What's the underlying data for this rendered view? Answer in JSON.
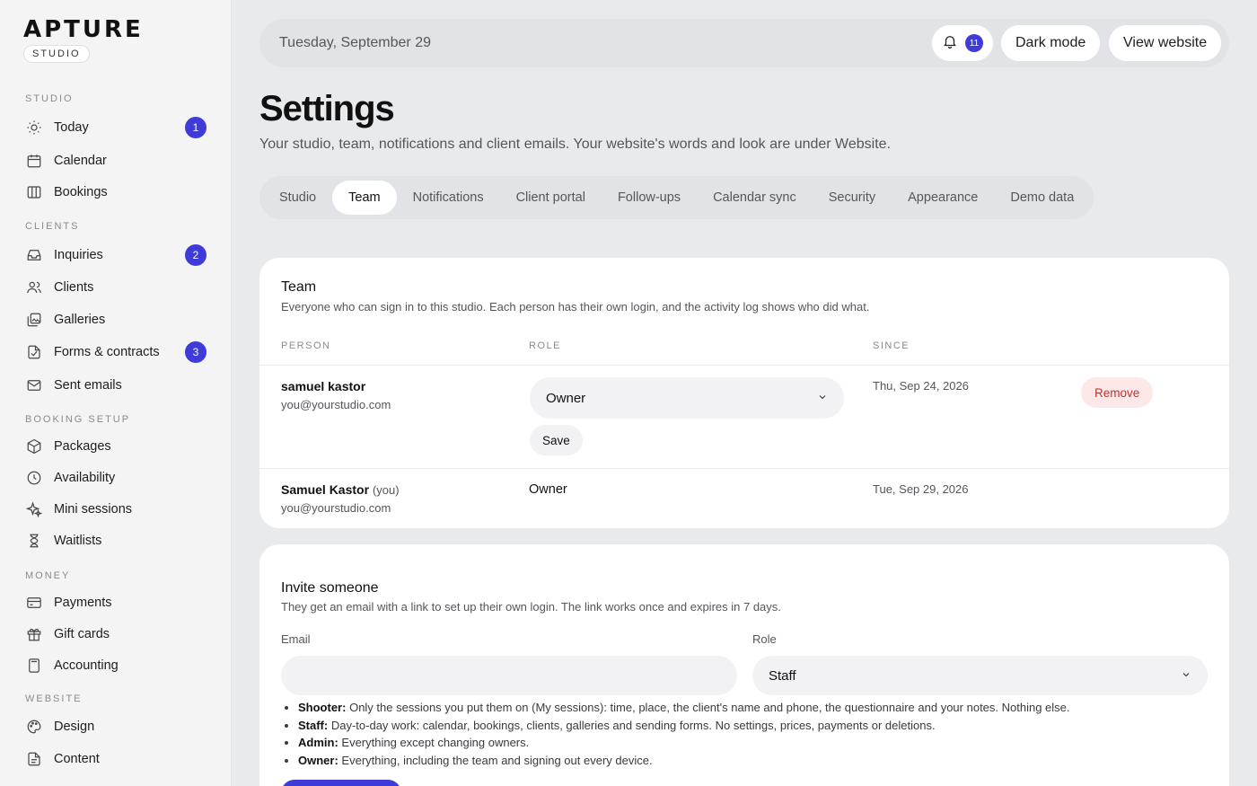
{
  "brand": {
    "logo": "APTURE",
    "tag": "STUDIO"
  },
  "sidebar": {
    "sections": [
      {
        "label": "STUDIO",
        "items": [
          {
            "label": "Today",
            "icon": "sun-icon",
            "badge": "1"
          },
          {
            "label": "Calendar",
            "icon": "calendar-icon"
          },
          {
            "label": "Bookings",
            "icon": "columns-icon"
          }
        ]
      },
      {
        "label": "CLIENTS",
        "items": [
          {
            "label": "Inquiries",
            "icon": "inbox-icon",
            "badge": "2"
          },
          {
            "label": "Clients",
            "icon": "users-icon"
          },
          {
            "label": "Galleries",
            "icon": "gallery-icon"
          },
          {
            "label": "Forms & contracts",
            "icon": "document-icon",
            "badge": "3"
          },
          {
            "label": "Sent emails",
            "icon": "mail-icon"
          }
        ]
      },
      {
        "label": "BOOKING SETUP",
        "items": [
          {
            "label": "Packages",
            "icon": "package-icon"
          },
          {
            "label": "Availability",
            "icon": "clock-icon"
          },
          {
            "label": "Mini sessions",
            "icon": "sparkles-icon"
          },
          {
            "label": "Waitlists",
            "icon": "hourglass-icon"
          }
        ]
      },
      {
        "label": "MONEY",
        "items": [
          {
            "label": "Payments",
            "icon": "credit-card-icon"
          },
          {
            "label": "Gift cards",
            "icon": "gift-icon"
          },
          {
            "label": "Accounting",
            "icon": "calculator-icon"
          }
        ]
      },
      {
        "label": "WEBSITE",
        "items": [
          {
            "label": "Design",
            "icon": "palette-icon"
          },
          {
            "label": "Content",
            "icon": "content-icon"
          }
        ]
      }
    ]
  },
  "topbar": {
    "date": "Tuesday, September 29",
    "notifications_count": "11",
    "dark_mode_label": "Dark mode",
    "view_website_label": "View website"
  },
  "header": {
    "title": "Settings",
    "subtitle": "Your studio, team, notifications and client emails. Your website's words and look are under Website."
  },
  "tabs": [
    "Studio",
    "Team",
    "Notifications",
    "Client portal",
    "Follow-ups",
    "Calendar sync",
    "Security",
    "Appearance",
    "Demo data"
  ],
  "active_tab": "Team",
  "team": {
    "title": "Team",
    "subtitle": "Everyone who can sign in to this studio. Each person has their own login, and the activity log shows who did what.",
    "columns": {
      "person": "PERSON",
      "role": "ROLE",
      "since": "SINCE"
    },
    "members": [
      {
        "name": "samuel kastor",
        "you": "",
        "email": "you@yourstudio.com",
        "role": "Owner",
        "since": "Thu, Sep 24, 2026",
        "save_label": "Save",
        "remove_label": "Remove"
      },
      {
        "name": "Samuel Kastor",
        "you": "(you)",
        "email": "you@yourstudio.com",
        "role": "Owner",
        "since": "Tue, Sep 29, 2026"
      }
    ]
  },
  "invite": {
    "title": "Invite someone",
    "subtitle": "They get an email with a link to set up their own login. The link works once and expires in 7 days.",
    "email_label": "Email",
    "email_value": "",
    "role_label": "Role",
    "role_value": "Staff",
    "roles": [
      {
        "name": "Shooter:",
        "desc": "Only the sessions you put them on (My sessions): time, place, the client's name and phone, the questionnaire and your notes. Nothing else."
      },
      {
        "name": "Staff:",
        "desc": "Day-to-day work: calendar, bookings, clients, galleries and sending forms. No settings, prices, payments or deletions."
      },
      {
        "name": "Admin:",
        "desc": "Everything except changing owners."
      },
      {
        "name": "Owner:",
        "desc": "Everything, including the team and signing out every device."
      }
    ]
  },
  "colors": {
    "accent": "#3f3bd9",
    "danger": "#c53030",
    "danger_bg": "#fde8e8"
  }
}
